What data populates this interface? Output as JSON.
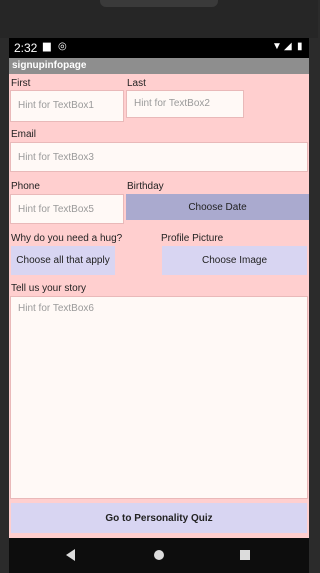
{
  "status_bar": {
    "time": "2:32",
    "icons": [
      "sd-card-icon",
      "sync-icon",
      "wifi-icon",
      "signal-icon",
      "battery-icon"
    ]
  },
  "app": {
    "title": "signupinfopage"
  },
  "form": {
    "first_label": "First",
    "first_placeholder": "Hint for TextBox1",
    "last_label": "Last",
    "last_placeholder": "Hint for TextBox2",
    "email_label": "Email",
    "email_placeholder": "Hint for TextBox3",
    "phone_label": "Phone",
    "phone_placeholder": "Hint for TextBox5",
    "birthday_label": "Birthday",
    "choose_date_button": "Choose Date",
    "hug_label": "Why do you need a hug?",
    "choose_all_button": "Choose all that apply",
    "profile_picture_label": "Profile Picture",
    "choose_image_button": "Choose Image",
    "story_label": "Tell us your story",
    "story_placeholder": "Hint for TextBox6",
    "submit_button": "Go to Personality Quiz"
  },
  "nav_bar": {
    "icons": [
      "back-icon",
      "home-icon",
      "recent-apps-icon"
    ]
  },
  "colors": {
    "background": "#ffcfcf",
    "primary_button": "#aaaacf",
    "secondary_button": "#d8d5f2",
    "title_bar": "#8e8e8e"
  }
}
